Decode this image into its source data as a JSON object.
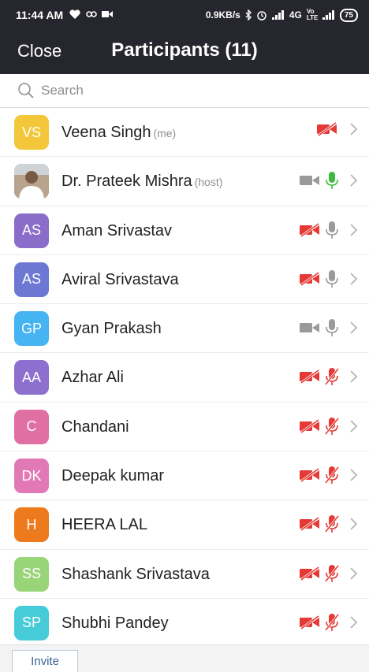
{
  "status_bar": {
    "time": "11:44 AM",
    "network_speed": "0.9KB/s",
    "network_type": "4G",
    "volte": "Vo LTE",
    "battery": "75"
  },
  "header": {
    "close_label": "Close",
    "title": "Participants (11)"
  },
  "search": {
    "placeholder": "Search"
  },
  "colors": {
    "header_bg": "#26262e",
    "muted_red": "#e53935",
    "mic_green": "#3dbb3d",
    "icon_gray": "#9a9a9a"
  },
  "participants": [
    {
      "initials": "VS",
      "name": "Veena Singh",
      "tag": "(me)",
      "avatar_color": "#f4c73a",
      "video": "off",
      "audio": "none"
    },
    {
      "initials": "",
      "name": "Dr. Prateek Mishra",
      "tag": "(host)",
      "avatar_color": "#7c8c94",
      "video": "on",
      "audio": "speaking",
      "photo": true
    },
    {
      "initials": "AS",
      "name": "Aman Srivastav",
      "tag": "",
      "avatar_color": "#8a6dc9",
      "video": "off",
      "audio": "on"
    },
    {
      "initials": "AS",
      "name": "Aviral Srivastava",
      "tag": "",
      "avatar_color": "#6c78d4",
      "video": "off",
      "audio": "on"
    },
    {
      "initials": "GP",
      "name": "Gyan Prakash",
      "tag": "",
      "avatar_color": "#46b3f2",
      "video": "on",
      "audio": "on"
    },
    {
      "initials": "AA",
      "name": "Azhar Ali",
      "tag": "",
      "avatar_color": "#8c6fcf",
      "video": "off",
      "audio": "muted"
    },
    {
      "initials": "C",
      "name": "Chandani",
      "tag": "",
      "avatar_color": "#e06fa3",
      "video": "off",
      "audio": "muted"
    },
    {
      "initials": "DK",
      "name": "Deepak kumar",
      "tag": "",
      "avatar_color": "#e279b6",
      "video": "off",
      "audio": "muted"
    },
    {
      "initials": "H",
      "name": "HEERA LAL",
      "tag": "",
      "avatar_color": "#ed7a1c",
      "video": "off",
      "audio": "muted"
    },
    {
      "initials": "SS",
      "name": "Shashank Srivastava",
      "tag": "",
      "avatar_color": "#99d479",
      "video": "off",
      "audio": "muted"
    },
    {
      "initials": "SP",
      "name": "Shubhi Pandey",
      "tag": "",
      "avatar_color": "#46cbd8",
      "video": "off",
      "audio": "muted"
    }
  ],
  "footer": {
    "invite_label": "Invite"
  }
}
